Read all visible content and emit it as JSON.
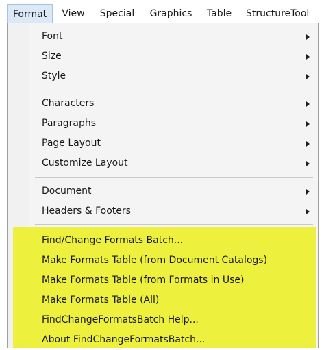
{
  "menubar": {
    "items": [
      {
        "label": "Format"
      },
      {
        "label": "View"
      },
      {
        "label": "Special"
      },
      {
        "label": "Graphics"
      },
      {
        "label": "Table"
      },
      {
        "label": "StructureTool"
      }
    ]
  },
  "format_menu": {
    "groups": [
      [
        {
          "label": "Font",
          "has_submenu": true
        },
        {
          "label": "Size",
          "has_submenu": true
        },
        {
          "label": "Style",
          "has_submenu": true
        }
      ],
      [
        {
          "label": "Characters",
          "has_submenu": true
        },
        {
          "label": "Paragraphs",
          "has_submenu": true
        },
        {
          "label": "Page Layout",
          "has_submenu": true
        },
        {
          "label": "Customize Layout",
          "has_submenu": true
        }
      ],
      [
        {
          "label": "Document",
          "has_submenu": true
        },
        {
          "label": "Headers & Footers",
          "has_submenu": true
        }
      ],
      [
        {
          "label": "Find/Change Formats Batch...",
          "has_submenu": false
        },
        {
          "label": "Make Formats Table (from Document Catalogs)",
          "has_submenu": false
        },
        {
          "label": "Make Formats Table (from Formats in Use)",
          "has_submenu": false
        },
        {
          "label": "Make Formats Table (All)",
          "has_submenu": false
        },
        {
          "label": "FindChangeFormatsBatch Help...",
          "has_submenu": false
        },
        {
          "label": "About FindChangeFormatsBatch...",
          "has_submenu": false
        }
      ]
    ],
    "highlight_color": "#eef03e"
  },
  "colors": {
    "active_menubar_bg": "#dbe8f5",
    "menu_bg": "#f4f4f4"
  },
  "icons": {
    "submenu_arrow": "submenu-arrow-icon"
  }
}
